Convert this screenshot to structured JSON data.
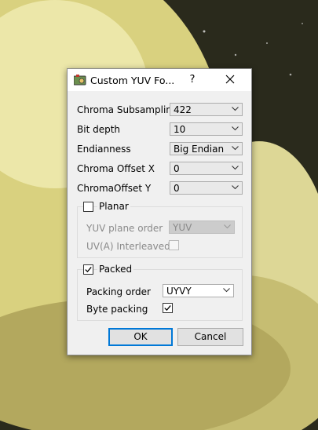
{
  "window": {
    "title": "Custom YUV Fo...",
    "help_label": "?",
    "close_icon": "close-icon",
    "app_icon": "app-icon"
  },
  "fields": {
    "chroma_subsampling": {
      "label": "Chroma Subsampling",
      "value": "422"
    },
    "bit_depth": {
      "label": "Bit depth",
      "value": "10"
    },
    "endianness": {
      "label": "Endianness",
      "value": "Big Endian"
    },
    "chroma_offset_x": {
      "label": "Chroma Offset X",
      "value": "0"
    },
    "chroma_offset_y": {
      "label": "ChromaOffset Y",
      "value": "0"
    }
  },
  "planar": {
    "label": "Planar",
    "checked": false,
    "plane_order_label": "YUV plane order",
    "plane_order_value": "YUV",
    "uv_interleaved_label": "UV(A) Interleaved",
    "uv_interleaved_checked": false
  },
  "packed": {
    "label": "Packed",
    "checked": true,
    "packing_order_label": "Packing order",
    "packing_order_value": "UYVY",
    "byte_packing_label": "Byte packing",
    "byte_packing_checked": true
  },
  "buttons": {
    "ok": "OK",
    "cancel": "Cancel"
  },
  "colors": {
    "accent": "#0078d7",
    "dialog_bg": "#f0f0f0",
    "disabled_text": "#8a8a8a"
  }
}
